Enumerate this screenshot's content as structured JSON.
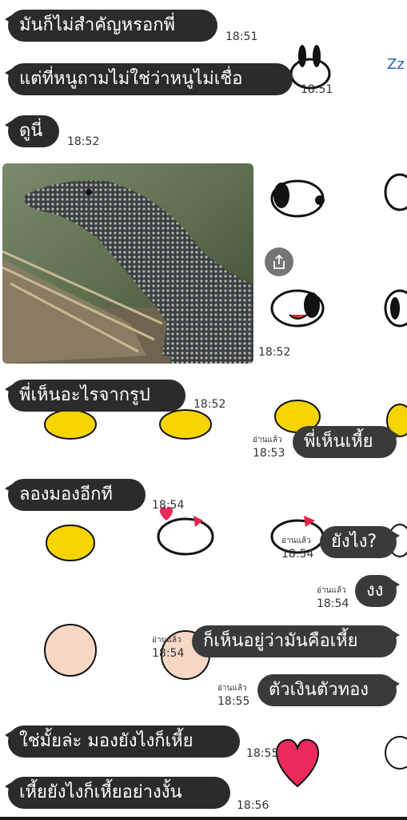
{
  "messages": [
    {
      "text": "มันก็ไม่สำคัญหรอกพี่",
      "time": "18:51"
    },
    {
      "text": "แต่ที่หนูถามไม่ใช่ว่าหนูไม่เชื่อ",
      "time": "18:51"
    },
    {
      "text": "ดูนี่",
      "time": "18:52"
    },
    {
      "photo_time": "18:52"
    },
    {
      "text": "พี่เห็นอะไรจากรูป",
      "time": "18:52"
    },
    {
      "text": "พี่เห็นเหี้ย",
      "time": "18:53",
      "read": "อ่านแล้ว"
    },
    {
      "text": "ลองมองอีกที",
      "time": "18:54"
    },
    {
      "text": "ยังไง?",
      "time": "18:54",
      "read": "อ่านแล้ว"
    },
    {
      "text": "งง",
      "time": "18:54",
      "read": "อ่านแล้ว"
    },
    {
      "text": "ก็เห็นอยู่ว่ามันคือเหี้ย",
      "time": "18:54",
      "read": "อ่านแล้ว"
    },
    {
      "text": "ตัวเงินตัวทอง",
      "time": "18:55",
      "read": "อ่านแล้ว"
    },
    {
      "text": "ใช่มั้ยล่ะ มองยังไงก็เหี้ย",
      "time": "18:55"
    },
    {
      "text": "เหี้ยยังไงก็เหี้ยอย่างงั้น",
      "time": "18:56"
    }
  ],
  "icons": {
    "share": "share-icon",
    "background": "snoopy-sticker-pattern"
  },
  "colors": {
    "bubble": "#2b2b2b",
    "bubble_text": "#ffffff",
    "background": "#ffffff"
  }
}
